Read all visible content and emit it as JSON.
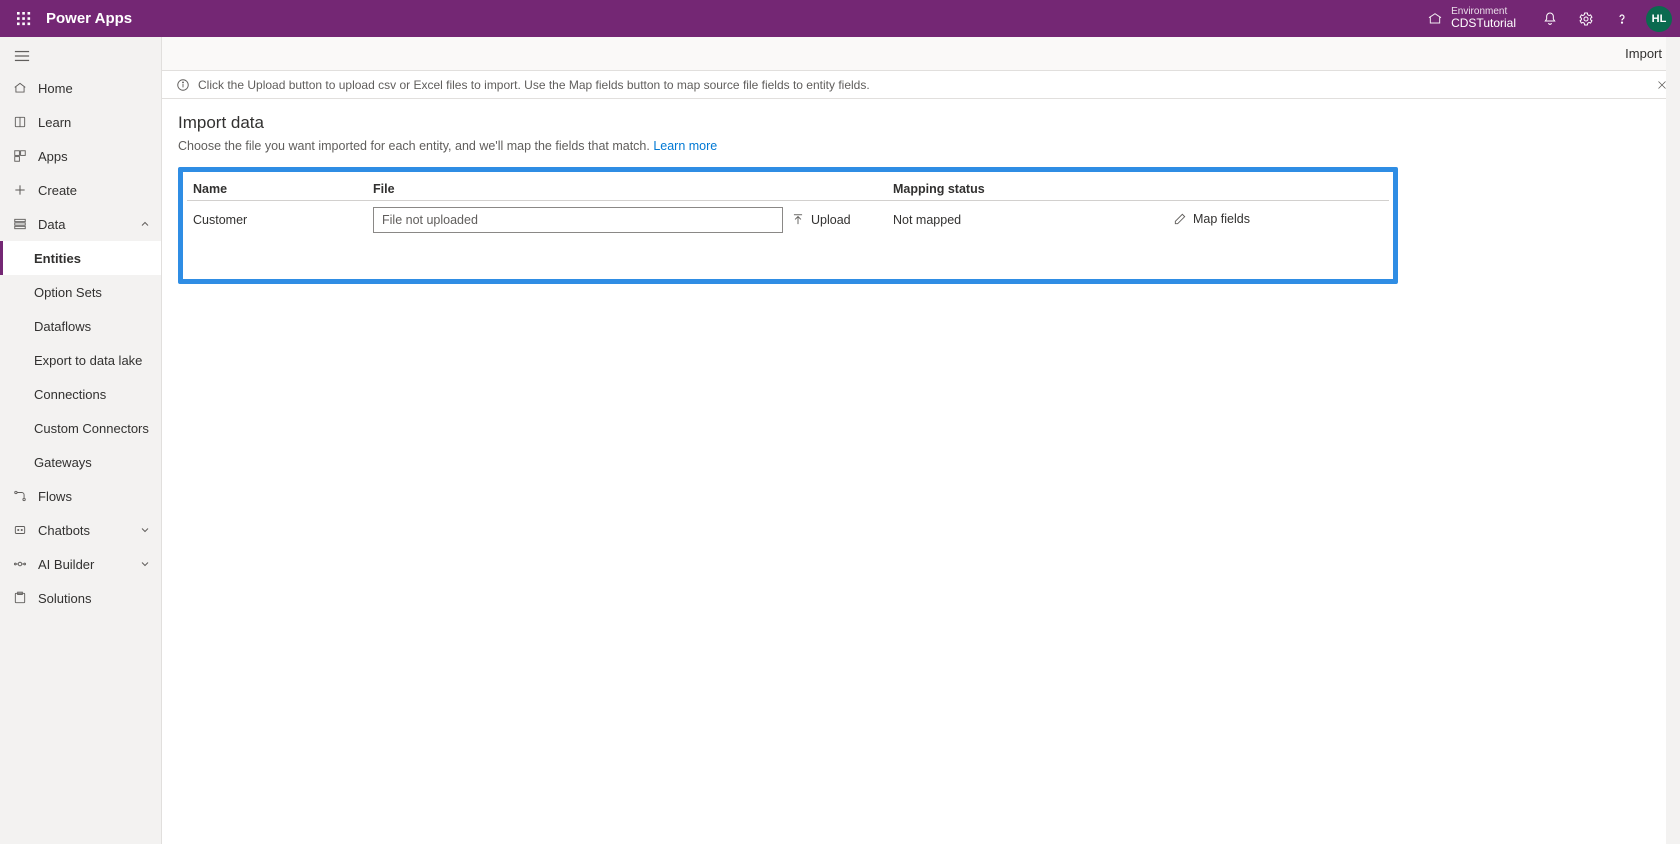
{
  "header": {
    "app_title": "Power Apps",
    "environment_label": "Environment",
    "environment_name": "CDSTutorial",
    "avatar_initials": "HL"
  },
  "sidebar": {
    "home": "Home",
    "learn": "Learn",
    "apps": "Apps",
    "create": "Create",
    "data": "Data",
    "data_children": {
      "entities": "Entities",
      "option_sets": "Option Sets",
      "dataflows": "Dataflows",
      "export_lake": "Export to data lake",
      "connections": "Connections",
      "custom_connectors": "Custom Connectors",
      "gateways": "Gateways"
    },
    "flows": "Flows",
    "chatbots": "Chatbots",
    "ai_builder": "AI Builder",
    "solutions": "Solutions"
  },
  "commands": {
    "import": "Import"
  },
  "infobar": {
    "text": "Click the Upload button to upload csv or Excel files to import. Use the Map fields button to map source file fields to entity fields."
  },
  "page": {
    "title": "Import data",
    "description_prefix": "Choose the file you want imported for each entity, and we'll map the fields that match. ",
    "learn_more": "Learn more"
  },
  "grid": {
    "columns": {
      "name": "Name",
      "file": "File",
      "mapping": "Mapping status"
    },
    "row": {
      "entity_name": "Customer",
      "file_placeholder": "File not uploaded",
      "upload_label": "Upload",
      "mapping_status": "Not mapped",
      "map_fields_label": "Map fields"
    }
  }
}
